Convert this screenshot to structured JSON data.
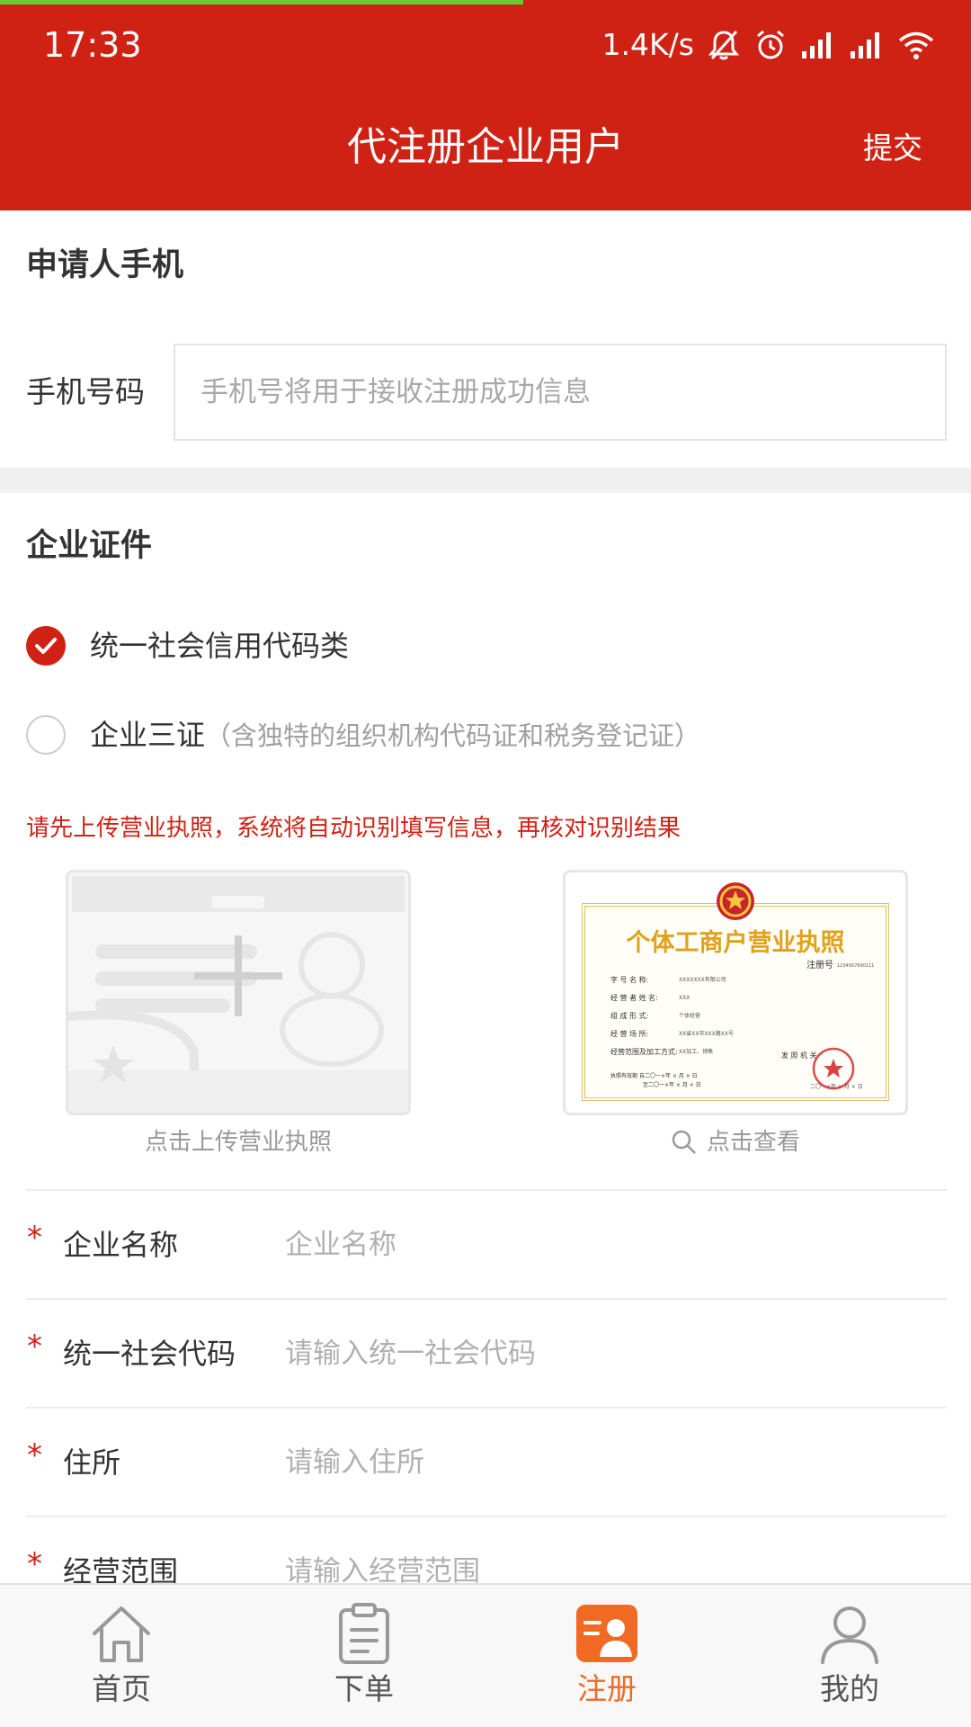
{
  "status_bar": {
    "time": "17:33",
    "net_speed": "1.4K/s",
    "icons": [
      "mute-bell-icon",
      "alarm-icon",
      "signal-icon",
      "signal-icon",
      "wifi-icon"
    ]
  },
  "navbar": {
    "title": "代注册企业用户",
    "submit_label": "提交"
  },
  "phone_section": {
    "title": "申请人手机",
    "phone_label": "手机号码",
    "phone_placeholder": "手机号将用于接收注册成功信息"
  },
  "cert_section": {
    "title": "企业证件",
    "options": [
      {
        "label": "统一社会信用代码类",
        "note": "",
        "selected": true
      },
      {
        "label": "企业三证",
        "note": "（含独特的组织机构代码证和税务登记证）",
        "selected": false
      }
    ],
    "hint": "请先上传营业执照，系统将自动识别填写信息，再核对识别结果",
    "upload_caption": "点击上传营业执照",
    "sample_caption": "点击查看",
    "sample_image": {
      "title": "个体工商户营业执照",
      "reg_label": "注册号",
      "reg_value": "1234567890111",
      "fields": [
        {
          "label": "字 号 名 称:",
          "value": "XXXXXXX有限公司"
        },
        {
          "label": "经 营 者 姓 名:",
          "value": "XXX"
        },
        {
          "label": "组 成 形 式:",
          "value": "个体经营"
        },
        {
          "label": "经 营 场 所:",
          "value": "XX省XX市XXX路XX号"
        },
        {
          "label": "经营范围及加工方式:",
          "value": "XX加工、销售"
        }
      ],
      "validity_label": "执照有效期",
      "validity_from": "自二〇一×年 × 月 × 日",
      "validity_to": "至二〇一×年 × 月 × 日",
      "issuer_label": "发 照 机 关",
      "issue_date": "二〇一×年 × 月 × 日"
    }
  },
  "form": {
    "fields": [
      {
        "label": "企业名称",
        "placeholder": "企业名称",
        "required": "*"
      },
      {
        "label": "统一社会代码",
        "placeholder": "请输入统一社会代码",
        "required": "*"
      },
      {
        "label": "住所",
        "placeholder": "请输入住所",
        "required": "*"
      },
      {
        "label": "经营范围",
        "placeholder": "请输入经营范围",
        "required": "*"
      }
    ]
  },
  "tabbar": {
    "tabs": [
      {
        "label": "首页",
        "icon": "home-icon",
        "active": false
      },
      {
        "label": "下单",
        "icon": "order-clipboard-icon",
        "active": false
      },
      {
        "label": "注册",
        "icon": "register-user-card-icon",
        "active": true
      },
      {
        "label": "我的",
        "icon": "profile-user-icon",
        "active": false
      }
    ]
  },
  "colors": {
    "brand_red": "#d02214",
    "active_orange": "#f06a24",
    "load_bar_green": "#66cc33",
    "certificate_gold": "#e0a21c"
  }
}
